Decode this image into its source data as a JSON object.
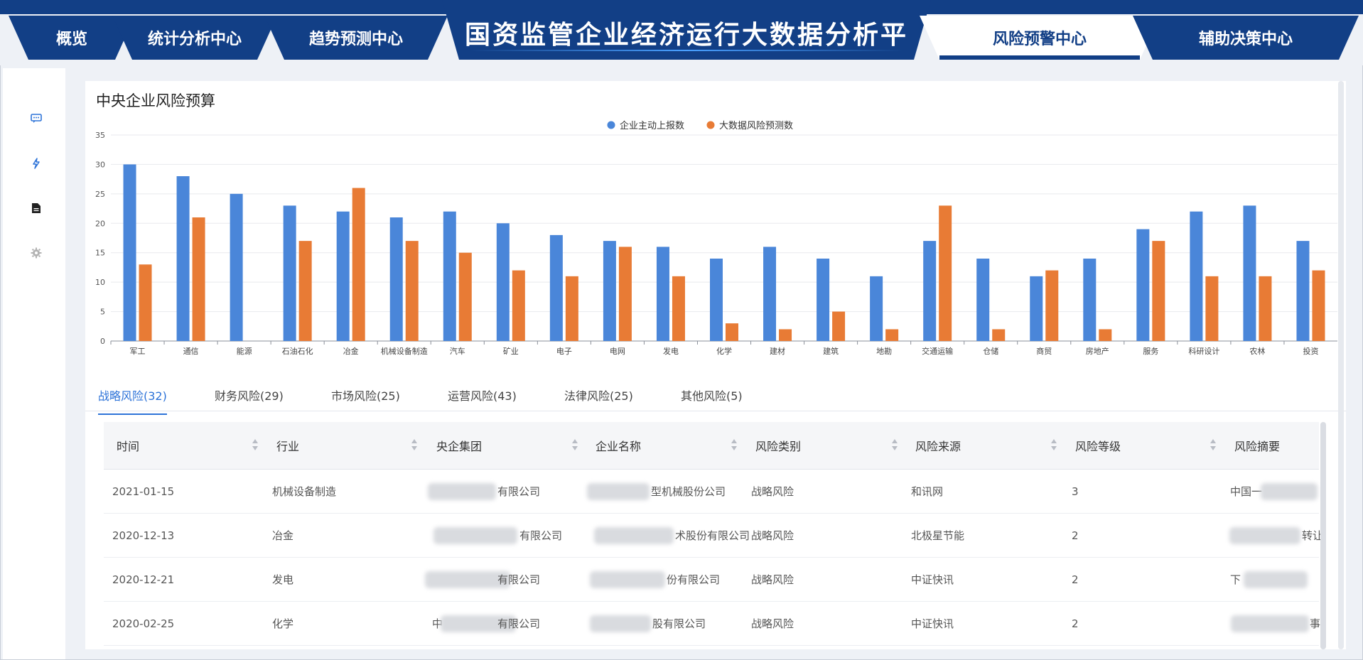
{
  "header": {
    "title": "国资监管企业经济运行大数据分析平",
    "tabs": [
      {
        "label": "概览",
        "active": false
      },
      {
        "label": "统计分析中心",
        "active": false
      },
      {
        "label": "趋势预测中心",
        "active": false
      },
      {
        "label": "风险预警中心",
        "active": true
      },
      {
        "label": "辅助决策中心",
        "active": false
      }
    ]
  },
  "sidebar": {
    "items": [
      {
        "icon": "chat-icon",
        "color": "#2d73d8"
      },
      {
        "icon": "lightning-icon",
        "color": "#2d73d8"
      },
      {
        "icon": "document-icon",
        "color": "#222222"
      },
      {
        "icon": "gear-icon",
        "color": "#b3b3b3"
      }
    ]
  },
  "chart_data": {
    "type": "bar",
    "title": "中央企业风险预算",
    "categories": [
      "军工",
      "通信",
      "能源",
      "石油石化",
      "冶金",
      "机械设备制造",
      "汽车",
      "矿业",
      "电子",
      "电网",
      "发电",
      "化学",
      "建材",
      "建筑",
      "地勘",
      "交通运输",
      "仓储",
      "商贸",
      "房地产",
      "服务",
      "科研设计",
      "农林",
      "投资"
    ],
    "series": [
      {
        "name": "企业主动上报数",
        "color": "#4a86d9",
        "values": [
          30,
          28,
          25,
          23,
          22,
          21,
          22,
          20,
          18,
          17,
          16,
          14,
          16,
          14,
          11,
          17,
          14,
          11,
          14,
          19,
          22,
          23,
          17
        ]
      },
      {
        "name": "大数据风险预测数",
        "color": "#e87b35",
        "values": [
          13,
          21,
          0,
          17,
          26,
          17,
          15,
          12,
          11,
          16,
          11,
          3,
          2,
          5,
          2,
          23,
          2,
          12,
          2,
          17,
          11,
          11,
          12
        ]
      }
    ],
    "ylim": [
      0,
      35
    ],
    "yticks": [
      0,
      5,
      10,
      15,
      20,
      25,
      30,
      35
    ],
    "legend_position": "top-center",
    "grid": true
  },
  "risk_tabs": [
    {
      "label": "战略风险(32)",
      "active": true
    },
    {
      "label": "财务风险(29)",
      "active": false
    },
    {
      "label": "市场风险(25)",
      "active": false
    },
    {
      "label": "运营风险(43)",
      "active": false
    },
    {
      "label": "法律风险(25)",
      "active": false
    },
    {
      "label": "其他风险(5)",
      "active": false
    }
  ],
  "table": {
    "columns": [
      "时间",
      "行业",
      "央企集团",
      "企业名称",
      "风险类别",
      "风险来源",
      "风险等级",
      "风险摘要"
    ],
    "rows": [
      {
        "time": "2021-01-15",
        "industry": "机械设备制造",
        "group": "有限公司",
        "company": "型机械股份公司",
        "category": "战略风险",
        "source": "和讯网",
        "level": "3",
        "summary": "中国一"
      },
      {
        "time": "2020-12-13",
        "industry": "冶金",
        "group": "有限公司",
        "company": "术股份有限公司",
        "category": "战略风险",
        "source": "北极星节能",
        "level": "2",
        "summary": "转让"
      },
      {
        "time": "2020-12-21",
        "industry": "发电",
        "group": "有限公司",
        "company": "份有限公司",
        "category": "战略风险",
        "source": "中证快讯",
        "level": "2",
        "summary": "下"
      },
      {
        "time": "2020-02-25",
        "industry": "化学",
        "group": "有限公司",
        "company": "股有限公司",
        "category": "战略风险",
        "source": "中证快讯",
        "level": "2",
        "summary": "事"
      }
    ]
  }
}
